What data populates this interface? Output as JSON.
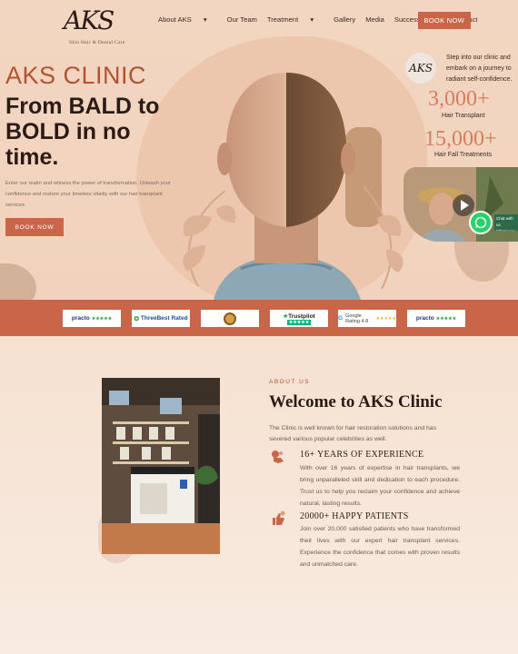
{
  "brand": {
    "logo_text": "AKS",
    "logo_subtitle": "Skin Hair & Dental Care"
  },
  "nav": {
    "items": [
      "About AKS",
      "Our Team",
      "Treatment",
      "Gallery",
      "Media",
      "Success Stories",
      "Contact"
    ],
    "book_label": "BOOK NOW"
  },
  "hero": {
    "title": "AKS CLINIC",
    "headline": "From BALD to BOLD in no time.",
    "description": "Enter our realm and witness the power of transformation. Unleash your confidence and restore your timeless vitality with our hair transplant services.",
    "book_label": "BOOK NOW"
  },
  "side": {
    "intro": "Step into our clinic and embark on a journey to radiant self-confidence.",
    "stats": [
      {
        "value": "3,000+",
        "label": "Hair Transplant"
      },
      {
        "value": "15,000+",
        "label": "Hair Fall Treatments"
      }
    ],
    "whatsapp_label": "Chat with us WhatsApp"
  },
  "badges": [
    {
      "name": "practo",
      "text": "practo"
    },
    {
      "name": "threebestrated",
      "text": "ThreeBest Rated"
    },
    {
      "name": "seal",
      "text": ""
    },
    {
      "name": "trustpilot",
      "text": "Trustpilot"
    },
    {
      "name": "google-rating",
      "text": "Google Rating 4.8"
    },
    {
      "name": "practo-2",
      "text": "practo"
    }
  ],
  "about": {
    "tag": "ABOUT US",
    "title": "Welcome to AKS Clinic",
    "intro": "The Clinic is well known for hair restoration solutions and has severed various popular celebrities as well.",
    "features": [
      {
        "title": "16+ YEARS OF EXPERIENCE",
        "text": "With over 16 years of expertise in hair transplants, we bring unparalleled skill and dedication to each procedure. Trust us to help you reclaim your confidence and achieve natural, lasting results."
      },
      {
        "title": "20000+ HAPPY PATIENTS",
        "text": "Join over 20,000 satisfied patients who have transformed their lives with our expert hair transplant services. Experience the confidence that comes with proven results and unmatched care."
      }
    ]
  },
  "colors": {
    "accent": "#c9664a",
    "title_red": "#b3532f",
    "stat_color": "#d77d5e",
    "hero_bg": "#f3d6c1"
  }
}
